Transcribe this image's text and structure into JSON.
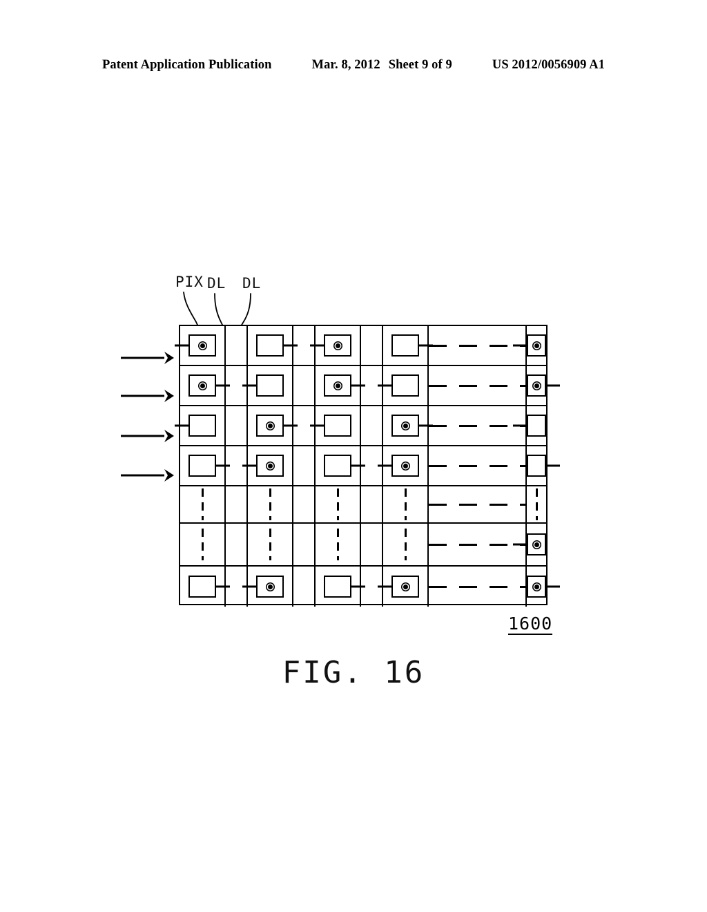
{
  "header": {
    "publication": "Patent Application Publication",
    "date": "Mar. 8, 2012",
    "sheet": "Sheet 9 of 9",
    "patent_number": "US 2012/0056909 A1"
  },
  "figure": {
    "caption": "FIG. 16",
    "reference_numeral": "1600",
    "labels": {
      "pix": "PIX",
      "dl_left": "DL",
      "dl_right": "DL"
    },
    "incident_arrows": {
      "count": 4,
      "direction": "right"
    },
    "grid": {
      "columns": 9,
      "rows": 7,
      "column_kinds": [
        "pixel",
        "gap",
        "pixel",
        "gap",
        "pixel",
        "gap",
        "pixel",
        "ellipsis",
        "pixel"
      ],
      "row_kinds": [
        "pixel",
        "pixel",
        "pixel",
        "pixel",
        "ellipsis",
        "mixed",
        "pixel"
      ],
      "cells": [
        [
          {
            "type": "pix",
            "dot": true,
            "stub": "left"
          },
          {
            "type": "gap"
          },
          {
            "type": "pix",
            "dot": false,
            "stub": "right"
          },
          {
            "type": "gap"
          },
          {
            "type": "pix",
            "dot": true,
            "stub": "left"
          },
          {
            "type": "gap"
          },
          {
            "type": "pix",
            "dot": false,
            "stub": "right"
          },
          {
            "type": "hdots"
          },
          {
            "type": "pix",
            "dot": true,
            "stub": "left"
          }
        ],
        [
          {
            "type": "pix",
            "dot": true,
            "stub": "right"
          },
          {
            "type": "gap"
          },
          {
            "type": "pix",
            "dot": false,
            "stub": "left"
          },
          {
            "type": "gap"
          },
          {
            "type": "pix",
            "dot": true,
            "stub": "right"
          },
          {
            "type": "gap"
          },
          {
            "type": "pix",
            "dot": false,
            "stub": "left"
          },
          {
            "type": "hdots"
          },
          {
            "type": "pix",
            "dot": true,
            "stub": "right"
          }
        ],
        [
          {
            "type": "pix",
            "dot": false,
            "stub": "left"
          },
          {
            "type": "gap"
          },
          {
            "type": "pix",
            "dot": true,
            "stub": "right"
          },
          {
            "type": "gap"
          },
          {
            "type": "pix",
            "dot": false,
            "stub": "left"
          },
          {
            "type": "gap"
          },
          {
            "type": "pix",
            "dot": true,
            "stub": "right"
          },
          {
            "type": "hdots"
          },
          {
            "type": "pix",
            "dot": false,
            "stub": "left"
          }
        ],
        [
          {
            "type": "pix",
            "dot": false,
            "stub": "right"
          },
          {
            "type": "gap"
          },
          {
            "type": "pix",
            "dot": true,
            "stub": "left"
          },
          {
            "type": "gap"
          },
          {
            "type": "pix",
            "dot": false,
            "stub": "right"
          },
          {
            "type": "gap"
          },
          {
            "type": "pix",
            "dot": true,
            "stub": "left"
          },
          {
            "type": "hdots"
          },
          {
            "type": "pix",
            "dot": false,
            "stub": "right"
          }
        ],
        [
          {
            "type": "vdots"
          },
          {
            "type": "gap"
          },
          {
            "type": "vdots"
          },
          {
            "type": "gap"
          },
          {
            "type": "vdots"
          },
          {
            "type": "gap"
          },
          {
            "type": "vdots"
          },
          {
            "type": "hdots"
          },
          {
            "type": "vdots"
          }
        ],
        [
          {
            "type": "vdots"
          },
          {
            "type": "gap"
          },
          {
            "type": "vdots"
          },
          {
            "type": "gap"
          },
          {
            "type": "vdots"
          },
          {
            "type": "gap"
          },
          {
            "type": "vdots"
          },
          {
            "type": "hdots"
          },
          {
            "type": "pix",
            "dot": true,
            "stub": "left"
          }
        ],
        [
          {
            "type": "pix",
            "dot": false,
            "stub": "right"
          },
          {
            "type": "gap"
          },
          {
            "type": "pix",
            "dot": true,
            "stub": "left"
          },
          {
            "type": "gap"
          },
          {
            "type": "pix",
            "dot": false,
            "stub": "right"
          },
          {
            "type": "gap"
          },
          {
            "type": "pix",
            "dot": true,
            "stub": "left"
          },
          {
            "type": "hdots"
          },
          {
            "type": "pix",
            "dot": true,
            "stub": "right"
          }
        ]
      ]
    }
  }
}
